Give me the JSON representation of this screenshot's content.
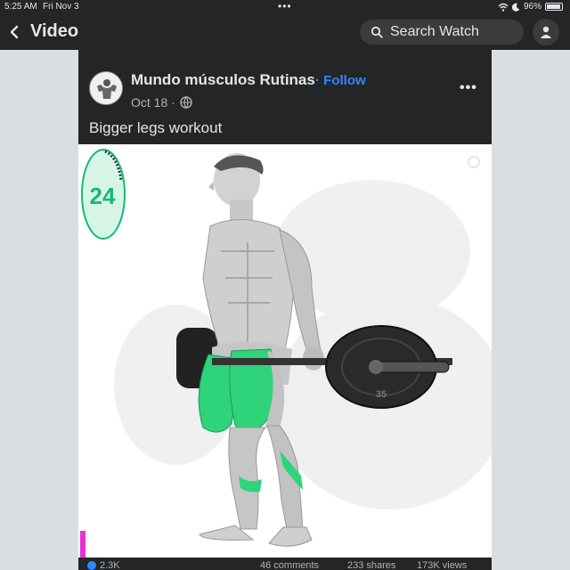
{
  "status_bar": {
    "time": "5:25 AM",
    "date": "Fri Nov 3",
    "battery": "96%",
    "battery_level": 0.96
  },
  "nav": {
    "back_icon": "chevron-left-icon",
    "title": "Video",
    "search_placeholder": "Search Watch",
    "profile_icon": "person-icon"
  },
  "post": {
    "author": "Mundo músculos Rutinas",
    "follow_label": "· Follow",
    "date": "Oct 18 ·",
    "privacy_icon": "globe-icon",
    "more_icon": "more-dots-icon",
    "caption": "Bigger legs workout"
  },
  "video": {
    "timer_value": "24",
    "plate_label": "35",
    "accent_color": "#2fd37a",
    "timer_color": "#16b87a"
  },
  "stats": {
    "reactions": "2.3K",
    "comments": "46 comments",
    "shares": "233 shares",
    "views": "173K views"
  }
}
